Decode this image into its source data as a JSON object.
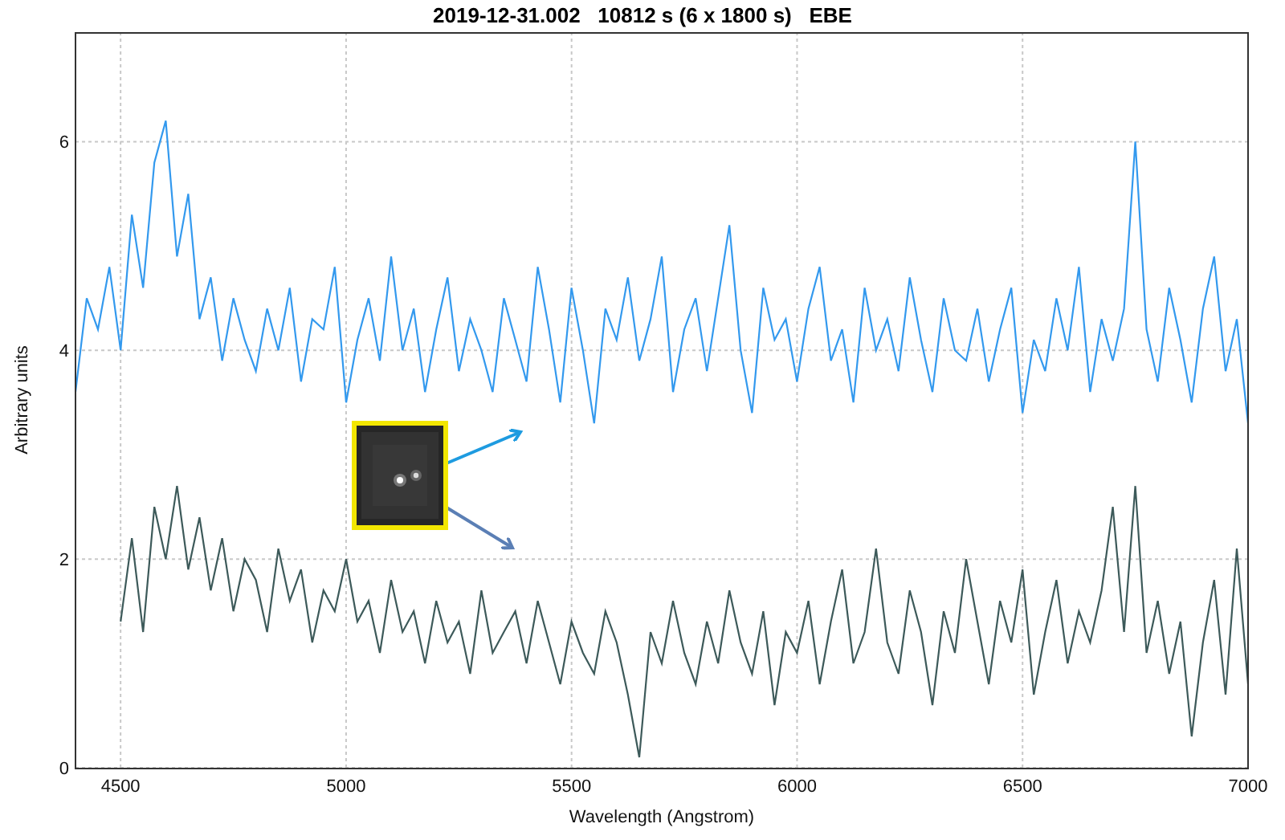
{
  "chart_data": {
    "type": "line",
    "title": "2019-12-31.002   10812 s (6 x 1800 s)   EBE",
    "xlabel": "Wavelength (Angstrom)",
    "ylabel": "Arbitrary units",
    "x": [
      4400,
      4425,
      4450,
      4475,
      4500,
      4525,
      4550,
      4575,
      4600,
      4625,
      4650,
      4675,
      4700,
      4725,
      4750,
      4775,
      4800,
      4825,
      4850,
      4875,
      4900,
      4925,
      4950,
      4975,
      5000,
      5025,
      5050,
      5075,
      5100,
      5125,
      5150,
      5175,
      5200,
      5225,
      5250,
      5275,
      5300,
      5325,
      5350,
      5375,
      5400,
      5425,
      5450,
      5475,
      5500,
      5525,
      5550,
      5575,
      5600,
      5625,
      5650,
      5675,
      5700,
      5725,
      5750,
      5775,
      5800,
      5825,
      5850,
      5875,
      5900,
      5925,
      5950,
      5975,
      6000,
      6025,
      6050,
      6075,
      6100,
      6125,
      6150,
      6175,
      6200,
      6225,
      6250,
      6275,
      6300,
      6325,
      6350,
      6375,
      6400,
      6425,
      6450,
      6475,
      6500,
      6525,
      6550,
      6575,
      6600,
      6625,
      6650,
      6675,
      6700,
      6725,
      6750,
      6775,
      6800,
      6825,
      6850,
      6875,
      6900,
      6925,
      6950,
      6975,
      7000
    ],
    "series": [
      {
        "color": "#3399ee",
        "values": [
          3.6,
          4.5,
          4.2,
          4.8,
          4.0,
          5.3,
          4.6,
          5.8,
          6.2,
          4.9,
          5.5,
          4.3,
          4.7,
          3.9,
          4.5,
          4.1,
          3.8,
          4.4,
          4.0,
          4.6,
          3.7,
          4.3,
          4.2,
          4.8,
          3.5,
          4.1,
          4.5,
          3.9,
          4.9,
          4.0,
          4.4,
          3.6,
          4.2,
          4.7,
          3.8,
          4.3,
          4.0,
          3.6,
          4.5,
          4.1,
          3.7,
          4.8,
          4.2,
          3.5,
          4.6,
          4.0,
          3.3,
          4.4,
          4.1,
          4.7,
          3.9,
          4.3,
          4.9,
          3.6,
          4.2,
          4.5,
          3.8,
          4.5,
          5.2,
          4.0,
          3.4,
          4.6,
          4.1,
          4.3,
          3.7,
          4.4,
          4.8,
          3.9,
          4.2,
          3.5,
          4.6,
          4.0,
          4.3,
          3.8,
          4.7,
          4.1,
          3.6,
          4.5,
          4.0,
          3.9,
          4.4,
          3.7,
          4.2,
          4.6,
          3.4,
          4.1,
          3.8,
          4.5,
          4.0,
          4.8,
          3.6,
          4.3,
          3.9,
          4.4,
          6.0,
          4.2,
          3.7,
          4.6,
          4.1,
          3.5,
          4.4,
          4.9,
          3.8,
          4.3,
          3.3
        ]
      },
      {
        "color": "#3d5a5a",
        "values": [
          null,
          null,
          null,
          null,
          1.4,
          2.2,
          1.3,
          2.5,
          2.0,
          2.7,
          1.9,
          2.4,
          1.7,
          2.2,
          1.5,
          2.0,
          1.8,
          1.3,
          2.1,
          1.6,
          1.9,
          1.2,
          1.7,
          1.5,
          2.0,
          1.4,
          1.6,
          1.1,
          1.8,
          1.3,
          1.5,
          1.0,
          1.6,
          1.2,
          1.4,
          0.9,
          1.7,
          1.1,
          1.3,
          1.5,
          1.0,
          1.6,
          1.2,
          0.8,
          1.4,
          1.1,
          0.9,
          1.5,
          1.2,
          0.7,
          0.1,
          1.3,
          1.0,
          1.6,
          1.1,
          0.8,
          1.4,
          1.0,
          1.7,
          1.2,
          0.9,
          1.5,
          0.6,
          1.3,
          1.1,
          1.6,
          0.8,
          1.4,
          1.9,
          1.0,
          1.3,
          2.1,
          1.2,
          0.9,
          1.7,
          1.3,
          0.6,
          1.5,
          1.1,
          2.0,
          1.4,
          0.8,
          1.6,
          1.2,
          1.9,
          0.7,
          1.3,
          1.8,
          1.0,
          1.5,
          1.2,
          1.7,
          2.5,
          1.3,
          2.7,
          1.1,
          1.6,
          0.9,
          1.4,
          0.3,
          1.2,
          1.8,
          0.7,
          2.1,
          0.8
        ]
      }
    ],
    "xlim": [
      4400,
      7000
    ],
    "ylim": [
      0,
      7.05
    ],
    "xticks": [
      4500,
      5000,
      5500,
      6000,
      6500,
      7000
    ],
    "yticks": [
      0,
      2,
      4,
      6
    ],
    "grid": true
  }
}
